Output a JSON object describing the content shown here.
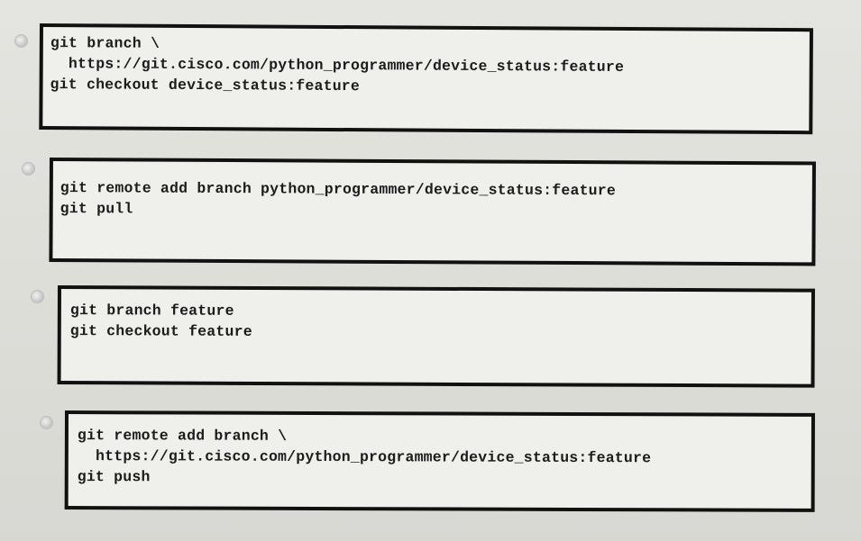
{
  "options": [
    {
      "lines": [
        "git branch \\",
        "  https://git.cisco.com/python_programmer/device_status:feature",
        "git checkout device_status:feature"
      ]
    },
    {
      "lines": [
        "git remote add branch python_programmer/device_status:feature",
        "git pull"
      ]
    },
    {
      "lines": [
        "git branch feature",
        "git checkout feature"
      ]
    },
    {
      "lines": [
        "git remote add branch \\",
        "  https://git.cisco.com/python_programmer/device_status:feature",
        "git push"
      ]
    }
  ]
}
